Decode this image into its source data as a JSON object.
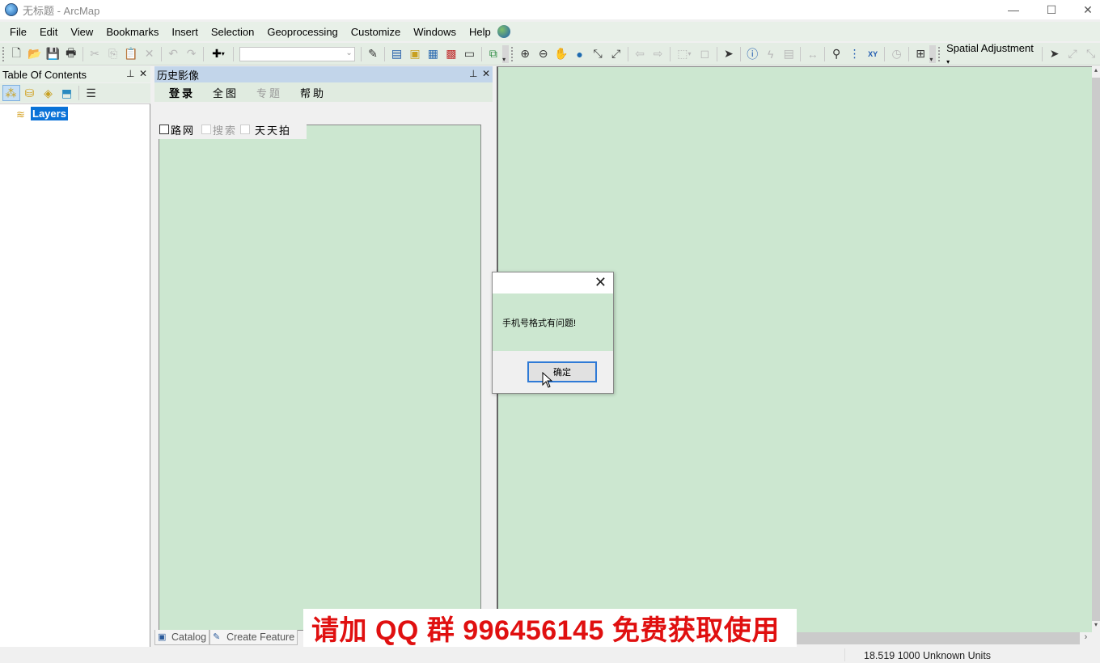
{
  "window": {
    "title": "无标题 - ArcMap",
    "controls": {
      "minimize": "—",
      "maximize": "☐",
      "close": "✕"
    }
  },
  "menu": [
    "File",
    "Edit",
    "View",
    "Bookmarks",
    "Insert",
    "Selection",
    "Geoprocessing",
    "Customize",
    "Windows",
    "Help"
  ],
  "toolbar": {
    "scale_combo_value": "",
    "spatial_adjustment_label": "Spatial Adjustment",
    "icons": {
      "new": "new-document-icon",
      "open": "open-folder-icon",
      "save": "save-icon",
      "print": "print-icon",
      "cut": "cut-icon",
      "copy": "copy-icon",
      "paste": "paste-icon",
      "delete": "delete-icon",
      "undo": "undo-icon",
      "redo": "redo-icon",
      "add_data": "add-data-icon"
    }
  },
  "toc": {
    "title": "Table Of Contents",
    "root_layer": "Layers"
  },
  "history_panel": {
    "title": "历史影像",
    "menu": [
      {
        "label": "登录",
        "state": "bold"
      },
      {
        "label": "全图",
        "state": "normal"
      },
      {
        "label": "专题",
        "state": "disabled"
      },
      {
        "label": "帮助",
        "state": "normal"
      }
    ],
    "checkboxes": [
      {
        "label": "路网",
        "checked": false,
        "enabled": true
      },
      {
        "label": "搜索",
        "checked": false,
        "enabled": false
      },
      {
        "label": "天天拍",
        "checked": false,
        "enabled": true
      }
    ]
  },
  "bottom_tabs": [
    "Catalog",
    "Create Feature"
  ],
  "dialog": {
    "message": "手机号格式有问题!",
    "ok_label": "确定",
    "close": "✕"
  },
  "status": {
    "coordinates": "18.519  1000 Unknown Units"
  },
  "banner": {
    "text": "请加 QQ 群  996456145  免费获取使用",
    "color": "#e01010"
  },
  "colors": {
    "map_background": "#cce7d0",
    "selection_blue": "#0a72d8",
    "panel_header": "#c2d5ea"
  }
}
